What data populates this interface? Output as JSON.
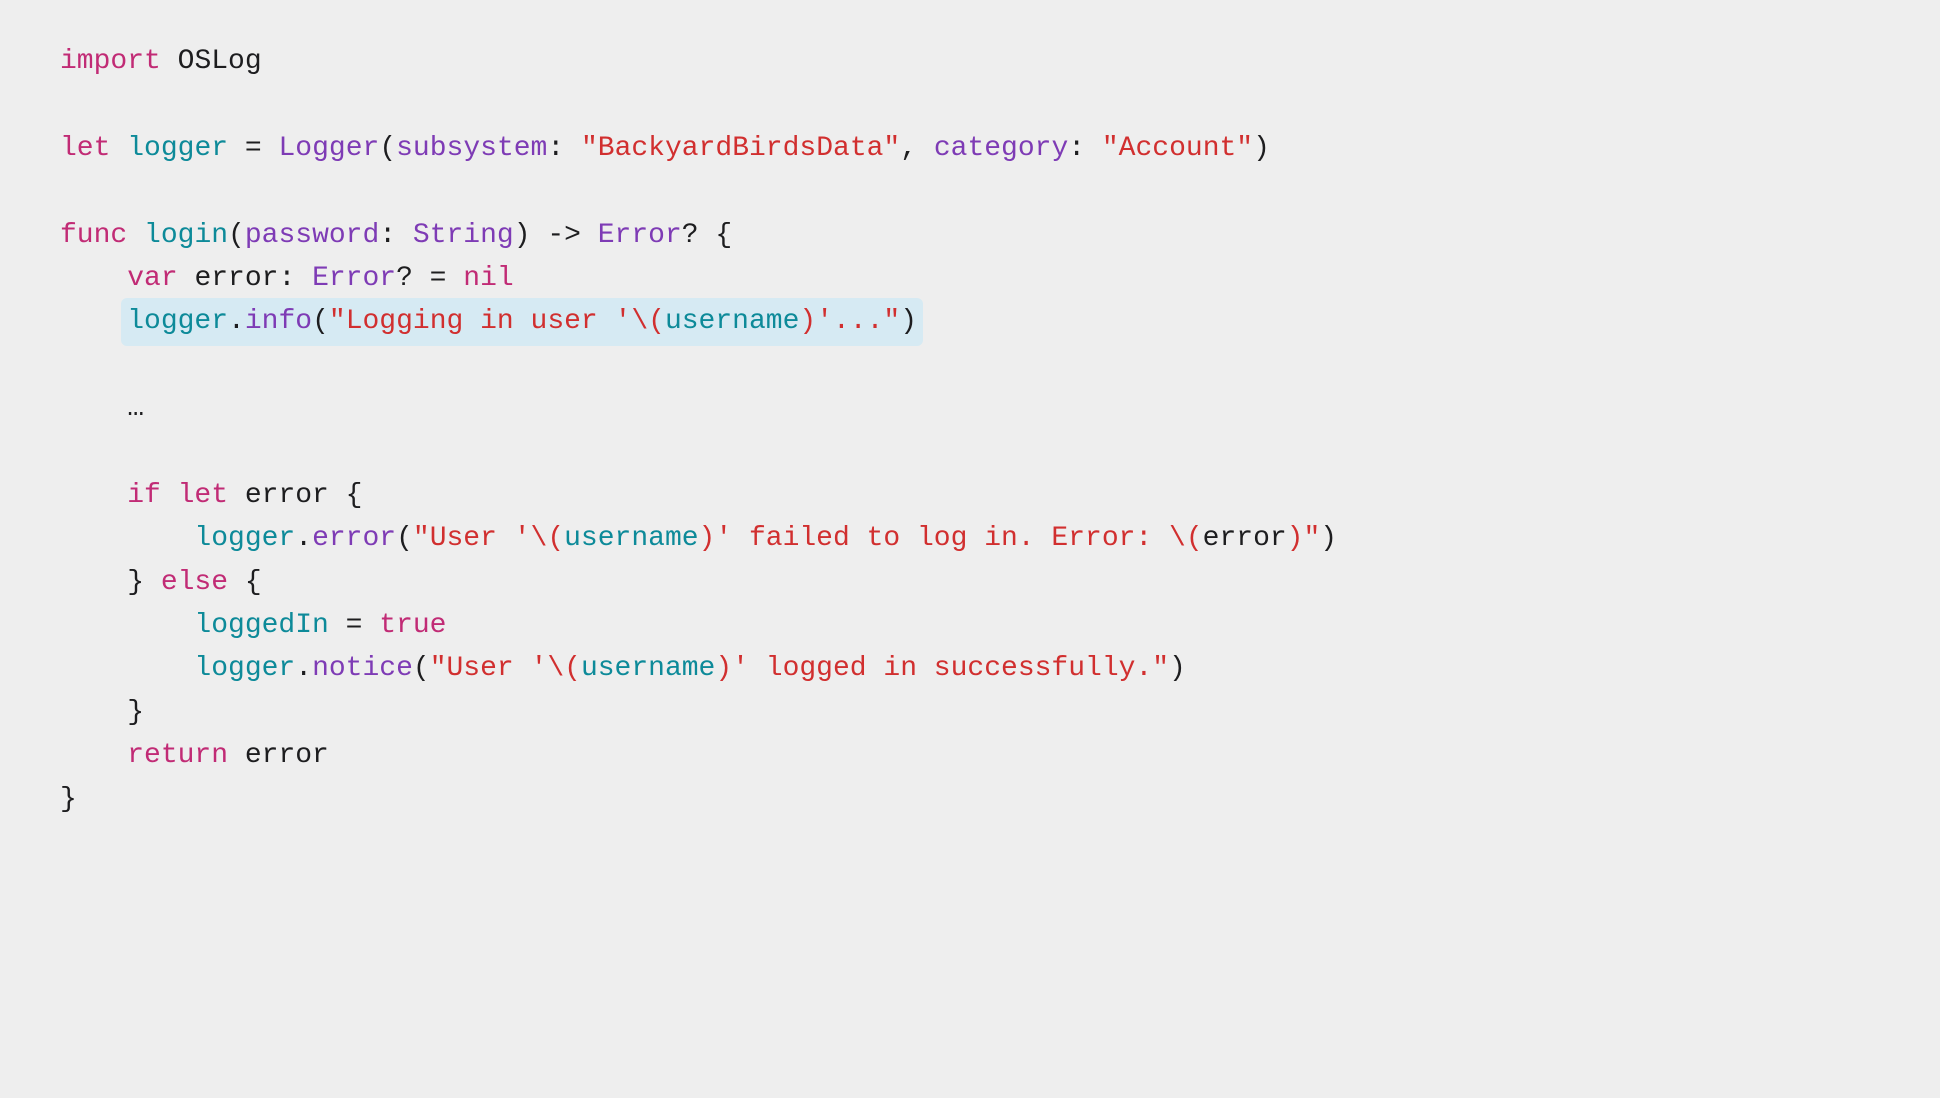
{
  "line1": {
    "kw_import": "import",
    "module": "OSLog"
  },
  "line3": {
    "kw_let": "let",
    "var_logger": "logger",
    "eq": " = ",
    "type_logger": "Logger",
    "paren_open": "(",
    "param_subsystem": "subsystem",
    "colon1": ": ",
    "str_subsystem": "\"BackyardBirdsData\"",
    "comma": ", ",
    "param_category": "category",
    "colon2": ": ",
    "str_category": "\"Account\"",
    "paren_close": ")"
  },
  "line5": {
    "kw_func": "func",
    "func_name": "login",
    "paren_open": "(",
    "param_password": "password",
    "colon": ": ",
    "type_string": "String",
    "paren_close": ") -> ",
    "type_error": "Error",
    "optional_brace": "? {"
  },
  "line6": {
    "kw_var": "var",
    "var_error": " error: ",
    "type_error": "Error",
    "optional": "? = ",
    "kw_nil": "nil"
  },
  "line7": {
    "var_logger": "logger",
    "dot": ".",
    "method_info": "info",
    "paren_open": "(",
    "str1": "\"Logging in user '",
    "interp_open": "\\(",
    "var_username": "username",
    "interp_close": ")",
    "str2": "'...\"",
    "paren_close": ")"
  },
  "line9": {
    "ellipsis": "…"
  },
  "line11": {
    "kw_if": "if",
    "kw_let": " let",
    "var_error": " error {"
  },
  "line12": {
    "var_logger": "logger",
    "dot": ".",
    "method_error": "error",
    "paren_open": "(",
    "str1": "\"User '",
    "interp_open1": "\\(",
    "var_username": "username",
    "interp_close1": ")",
    "str2": "' failed to log in. Error: ",
    "interp_open2": "\\(",
    "var_error": "error",
    "interp_close2": ")",
    "str3": "\"",
    "paren_close": ")"
  },
  "line13": {
    "close_brace": "} ",
    "kw_else": "else",
    "open_brace": " {"
  },
  "line14": {
    "var_loggedIn": "loggedIn",
    "eq": " = ",
    "kw_true": "true"
  },
  "line15": {
    "var_logger": "logger",
    "dot": ".",
    "method_notice": "notice",
    "paren_open": "(",
    "str1": "\"User '",
    "interp_open": "\\(",
    "var_username": "username",
    "interp_close": ")",
    "str2": "' logged in successfully.\"",
    "paren_close": ")"
  },
  "line16": {
    "close_brace": "}"
  },
  "line17": {
    "kw_return": "return",
    "var_error": " error"
  },
  "line18": {
    "close_brace": "}"
  }
}
